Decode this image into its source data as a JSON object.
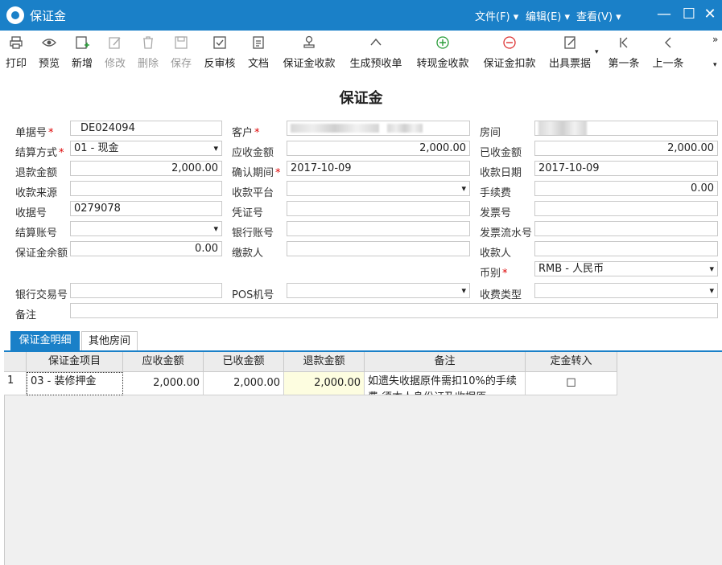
{
  "window": {
    "title": "保证金",
    "menus": [
      "文件(F)",
      "编辑(E)",
      "查看(V)"
    ]
  },
  "toolbar": [
    {
      "label": "打印",
      "icon": "print-icon",
      "enabled": true
    },
    {
      "label": "预览",
      "icon": "eye-icon",
      "enabled": true
    },
    {
      "label": "新增",
      "icon": "add-doc-icon",
      "enabled": true
    },
    {
      "label": "修改",
      "icon": "edit-icon",
      "enabled": false
    },
    {
      "label": "删除",
      "icon": "trash-icon",
      "enabled": false
    },
    {
      "label": "保存",
      "icon": "save-icon",
      "enabled": false
    },
    {
      "label": "反审核",
      "icon": "unaudit-icon",
      "enabled": true
    },
    {
      "label": "文档",
      "icon": "document-icon",
      "enabled": true
    },
    {
      "label": "保证金收款",
      "icon": "stamp-icon",
      "enabled": true
    },
    {
      "label": "生成预收单",
      "icon": "chevron-up-icon",
      "enabled": true
    },
    {
      "label": "转现金收款",
      "icon": "plus-circle-icon",
      "enabled": true
    },
    {
      "label": "保证金扣款",
      "icon": "minus-circle-icon",
      "enabled": true
    },
    {
      "label": "出具票据",
      "icon": "receipt-icon",
      "enabled": true
    },
    {
      "label": "第一条",
      "icon": "first-icon",
      "enabled": true
    },
    {
      "label": "上一条",
      "icon": "prev-icon",
      "enabled": true
    }
  ],
  "form": {
    "title": "保证金",
    "fields": {
      "doc_no": {
        "label": "单据号",
        "value": "DE024094"
      },
      "customer": {
        "label": "客户"
      },
      "room": {
        "label": "房间"
      },
      "settle_method": {
        "label": "结算方式",
        "value": "01 - 现金"
      },
      "receivable": {
        "label": "应收金额",
        "value": "2,000.00"
      },
      "received": {
        "label": "已收金额",
        "value": "2,000.00"
      },
      "refund": {
        "label": "退款金额",
        "value": "2,000.00"
      },
      "confirm_period": {
        "label": "确认期间",
        "value": "2017-10-09"
      },
      "receive_date": {
        "label": "收款日期",
        "value": "2017-10-09"
      },
      "receive_source": {
        "label": "收款来源",
        "value": ""
      },
      "receive_platform": {
        "label": "收款平台",
        "value": ""
      },
      "fee": {
        "label": "手续费",
        "value": "0.00"
      },
      "receipt_no": {
        "label": "收据号",
        "value": "0279078"
      },
      "voucher_no": {
        "label": "凭证号",
        "value": ""
      },
      "invoice_no": {
        "label": "发票号",
        "value": ""
      },
      "settle_account": {
        "label": "结算账号",
        "value": ""
      },
      "bank_account": {
        "label": "银行账号",
        "value": ""
      },
      "invoice_serial": {
        "label": "发票流水号",
        "value": ""
      },
      "deposit_balance": {
        "label": "保证金余额",
        "value": "0.00"
      },
      "payer": {
        "label": "缴款人",
        "value": ""
      },
      "payee": {
        "label": "收款人",
        "value": ""
      },
      "currency": {
        "label": "币别",
        "value": "RMB - 人民币"
      },
      "bank_txn_no": {
        "label": "银行交易号",
        "value": ""
      },
      "pos_no": {
        "label": "POS机号",
        "value": ""
      },
      "fee_type": {
        "label": "收费类型",
        "value": ""
      },
      "remark": {
        "label": "备注",
        "value": ""
      }
    }
  },
  "tabs": [
    {
      "label": "保证金明细",
      "active": true
    },
    {
      "label": "其他房间",
      "active": false
    }
  ],
  "grid": {
    "headers": [
      "保证金项目",
      "应收金额",
      "已收金额",
      "退款金额",
      "备注",
      "定金转入"
    ],
    "rows": [
      {
        "num": "1",
        "item": "03 - 装修押金",
        "receivable": "2,000.00",
        "received": "2,000.00",
        "refund": "2,000.00",
        "remark": "如遗失收据原件需扣10%的手续费,须本人身份证及收据原",
        "transfer": "☐"
      }
    ]
  }
}
